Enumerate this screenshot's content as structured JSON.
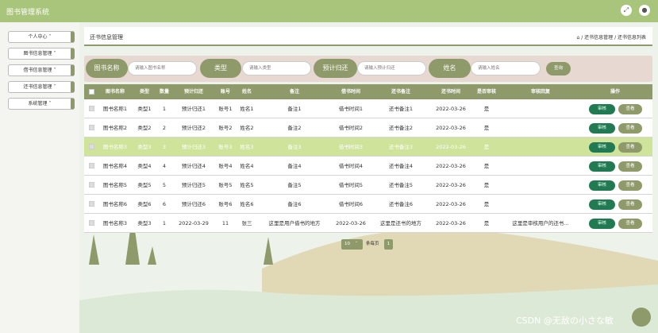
{
  "app": {
    "title": "图书管理系统",
    "expand_icon": "expand-icon",
    "user_icon": "user-icon"
  },
  "sidebar": {
    "items": [
      {
        "label": "个人中心"
      },
      {
        "label": "图书信息管理"
      },
      {
        "label": "借书信息管理"
      },
      {
        "label": "还书信息管理"
      },
      {
        "label": "系统管理"
      }
    ]
  },
  "header": {
    "page_title": "还书信息管理",
    "home_icon": "home-icon",
    "breadcrumb": "/ 还书信息管理 / 还书信息列表"
  },
  "search": {
    "fields": [
      {
        "label": "图书名称",
        "placeholder": "请输入图书名称"
      },
      {
        "label": "类型",
        "placeholder": "请输入类型"
      },
      {
        "label": "预计归还",
        "placeholder": "请输入预计归还"
      },
      {
        "label": "姓名",
        "placeholder": "请输入姓名"
      }
    ],
    "button_label": "查询"
  },
  "table": {
    "columns": [
      "图书名称",
      "类型",
      "数量",
      "预计归还",
      "账号",
      "姓名",
      "备注",
      "借书时间",
      "还书备注",
      "还书时间",
      "是否审核",
      "审核回复",
      "操作"
    ],
    "rows": [
      {
        "cells": [
          "图书名称1",
          "类型1",
          "1",
          "预计归还1",
          "账号1",
          "姓名1",
          "备注1",
          "借书时间1",
          "还书备注1",
          "2022-03-26",
          "是",
          ""
        ],
        "selected": false
      },
      {
        "cells": [
          "图书名称2",
          "类型2",
          "2",
          "预计归还2",
          "账号2",
          "姓名2",
          "备注2",
          "借书时间2",
          "还书备注2",
          "2022-03-26",
          "是",
          ""
        ],
        "selected": false
      },
      {
        "cells": [
          "图书名称3",
          "类型3",
          "3",
          "预计归还3",
          "账号3",
          "姓名3",
          "备注3",
          "借书时间3",
          "还书备注3",
          "2022-03-26",
          "是",
          ""
        ],
        "selected": true
      },
      {
        "cells": [
          "图书名称4",
          "类型4",
          "4",
          "预计归还4",
          "账号4",
          "姓名4",
          "备注4",
          "借书时间4",
          "还书备注4",
          "2022-03-26",
          "是",
          ""
        ],
        "selected": false
      },
      {
        "cells": [
          "图书名称5",
          "类型5",
          "5",
          "预计归还5",
          "账号5",
          "姓名5",
          "备注5",
          "借书时间5",
          "还书备注5",
          "2022-03-26",
          "是",
          ""
        ],
        "selected": false
      },
      {
        "cells": [
          "图书名称6",
          "类型6",
          "6",
          "预计归还6",
          "账号6",
          "姓名6",
          "备注6",
          "借书时间6",
          "还书备注6",
          "2022-03-26",
          "是",
          ""
        ],
        "selected": false
      },
      {
        "cells": [
          "图书名称3",
          "类型3",
          "1",
          "2022-03-29",
          "11",
          "张三",
          "这里是用户借书的地方",
          "2022-03-26",
          "这里是还书的地方",
          "2022-03-26",
          "是",
          "这里是审核用户的还书..."
        ],
        "selected": false
      }
    ],
    "audit_label": "审核",
    "view_label": "查看"
  },
  "pagination": {
    "page_size": "10",
    "per_page_label": "条每页",
    "current_page": "1"
  },
  "watermark": "CSDN @无敌の小さな敏",
  "colors": {
    "accent": "#8e9a6a",
    "topbar": "#a9c47b",
    "selected_row": "#cfe39a",
    "audit_button": "#227a52"
  }
}
